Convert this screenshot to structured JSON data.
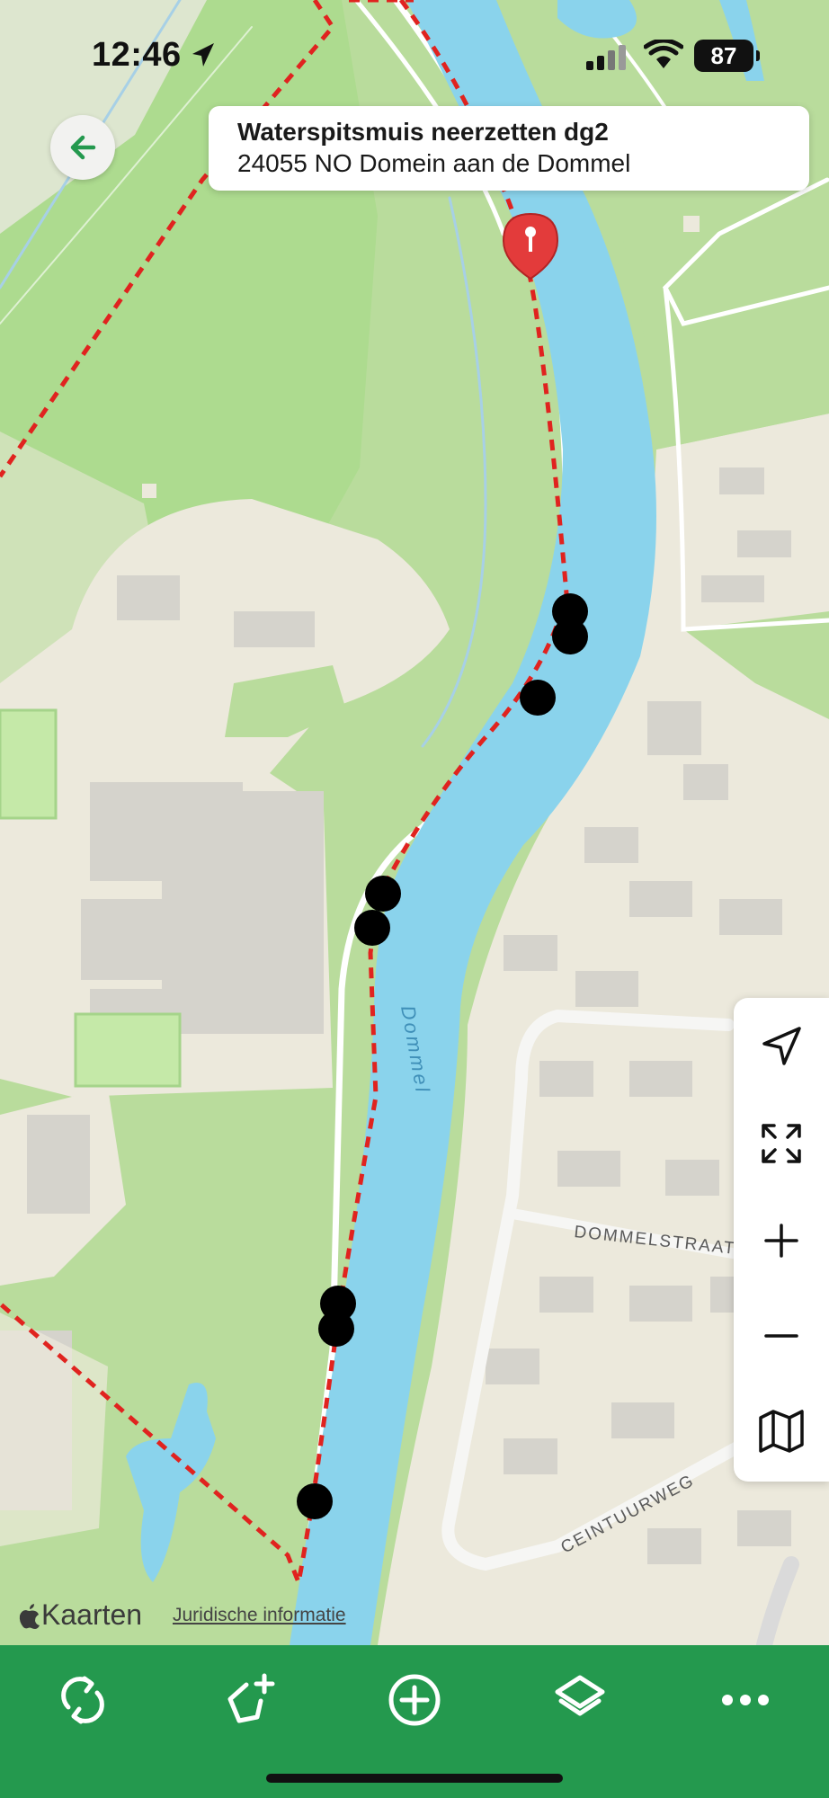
{
  "status_bar": {
    "time": "12:46",
    "battery": "87"
  },
  "header": {
    "title": "Waterspitsmuis neerzetten dg2",
    "subtitle": "24055 NO Domein aan de Dommel"
  },
  "map": {
    "river_label": "Dommel",
    "street_labels": [
      "DOMMELSTRAAT",
      "CEINTUURWEG"
    ],
    "attribution": "Kaarten",
    "legal_link": "Juridische informatie",
    "colors": {
      "river": "#8ad3ec",
      "park": "#b9dc9c",
      "urban": "#ece9dc",
      "route": "#e0231f",
      "accent": "#24994e"
    }
  },
  "controls": [
    "locate-icon",
    "fit-extent-icon",
    "zoom-in-icon",
    "zoom-out-icon",
    "map-layers-icon"
  ],
  "toolbar": [
    "sync-icon",
    "add-polygon-icon",
    "add-point-icon",
    "layers-icon",
    "more-icon"
  ]
}
